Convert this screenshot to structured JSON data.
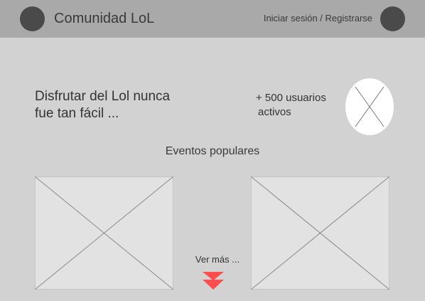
{
  "header": {
    "brand": "Comunidad LoL",
    "auth_link": "Iniciar sesión / Registrarse"
  },
  "hero": {
    "tagline_line1": "Disfrutar del Lol nunca",
    "tagline_line2": "fue tan fácil ...",
    "users_line1": "+ 500 usuarios",
    "users_line2": "activos"
  },
  "events": {
    "title": "Eventos populares",
    "see_more": "Ver más ..."
  },
  "colors": {
    "background": "#d2d2d2",
    "header": "#a9a9a9",
    "placeholder": "#e2e2e2",
    "dark_circle": "#4a4a4a",
    "accent_arrow": "#ff4d4d"
  },
  "icons": {
    "expand": "double-chevron-down-icon"
  }
}
